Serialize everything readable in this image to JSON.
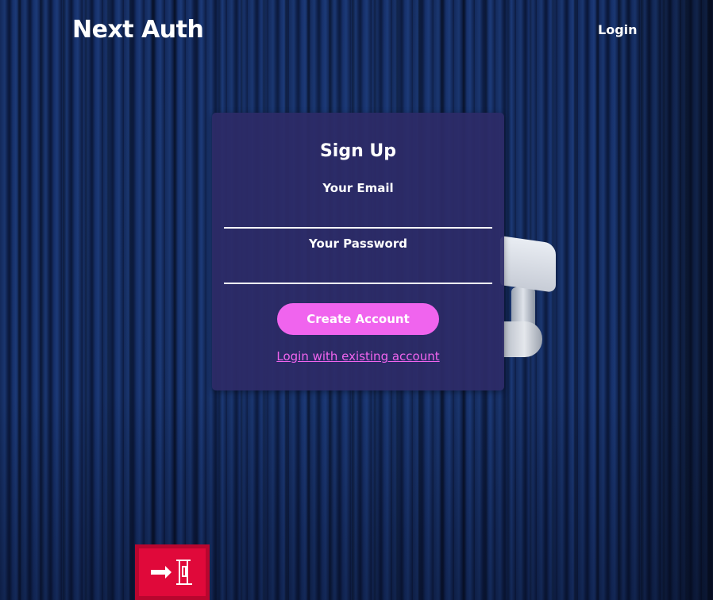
{
  "header": {
    "logo": "Next Auth",
    "nav_login": "Login"
  },
  "auth_card": {
    "title": "Sign Up",
    "email_label": "Your Email",
    "email_value": "",
    "password_label": "Your Password",
    "password_value": "",
    "submit_label": "Create Account",
    "switch_link": "Login with existing account"
  },
  "colors": {
    "accent": "#f064ee",
    "card_background": "#2d2b67",
    "page_background": "#0f1f45"
  },
  "icons": {
    "exit_sign": "fire-exit-sign-icon"
  }
}
